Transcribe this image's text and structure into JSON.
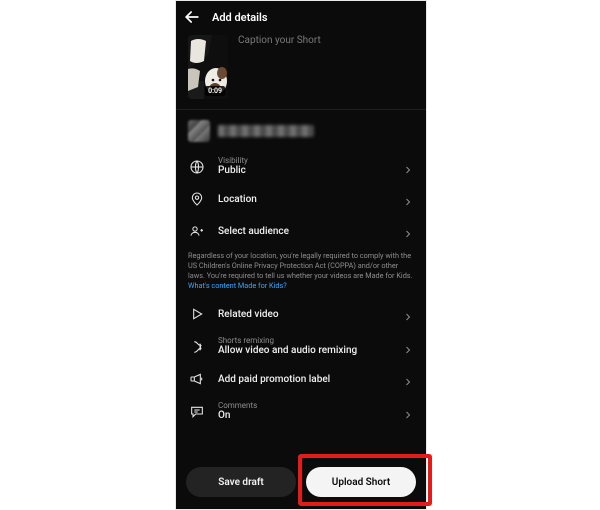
{
  "header": {
    "title": "Add details"
  },
  "caption": {
    "placeholder": "Caption your Short",
    "duration": "0:09"
  },
  "rows": {
    "visibility": {
      "sup": "Visibility",
      "value": "Public"
    },
    "location": {
      "label": "Location"
    },
    "audience": {
      "label": "Select audience"
    },
    "related": {
      "label": "Related video"
    },
    "remix": {
      "sup": "Shorts remixing",
      "value": "Allow video and audio remixing"
    },
    "paid": {
      "label": "Add paid promotion label"
    },
    "comments": {
      "sup": "Comments",
      "value": "On"
    }
  },
  "disclaimer": {
    "text": "Regardless of your location, you're legally required to comply with the US Children's Online Privacy Protection Act (COPPA) and/or other laws. You're required to tell us whether your videos are Made for Kids. ",
    "link": "What's content Made for Kids?"
  },
  "footer": {
    "draft": "Save draft",
    "upload": "Upload Short"
  }
}
